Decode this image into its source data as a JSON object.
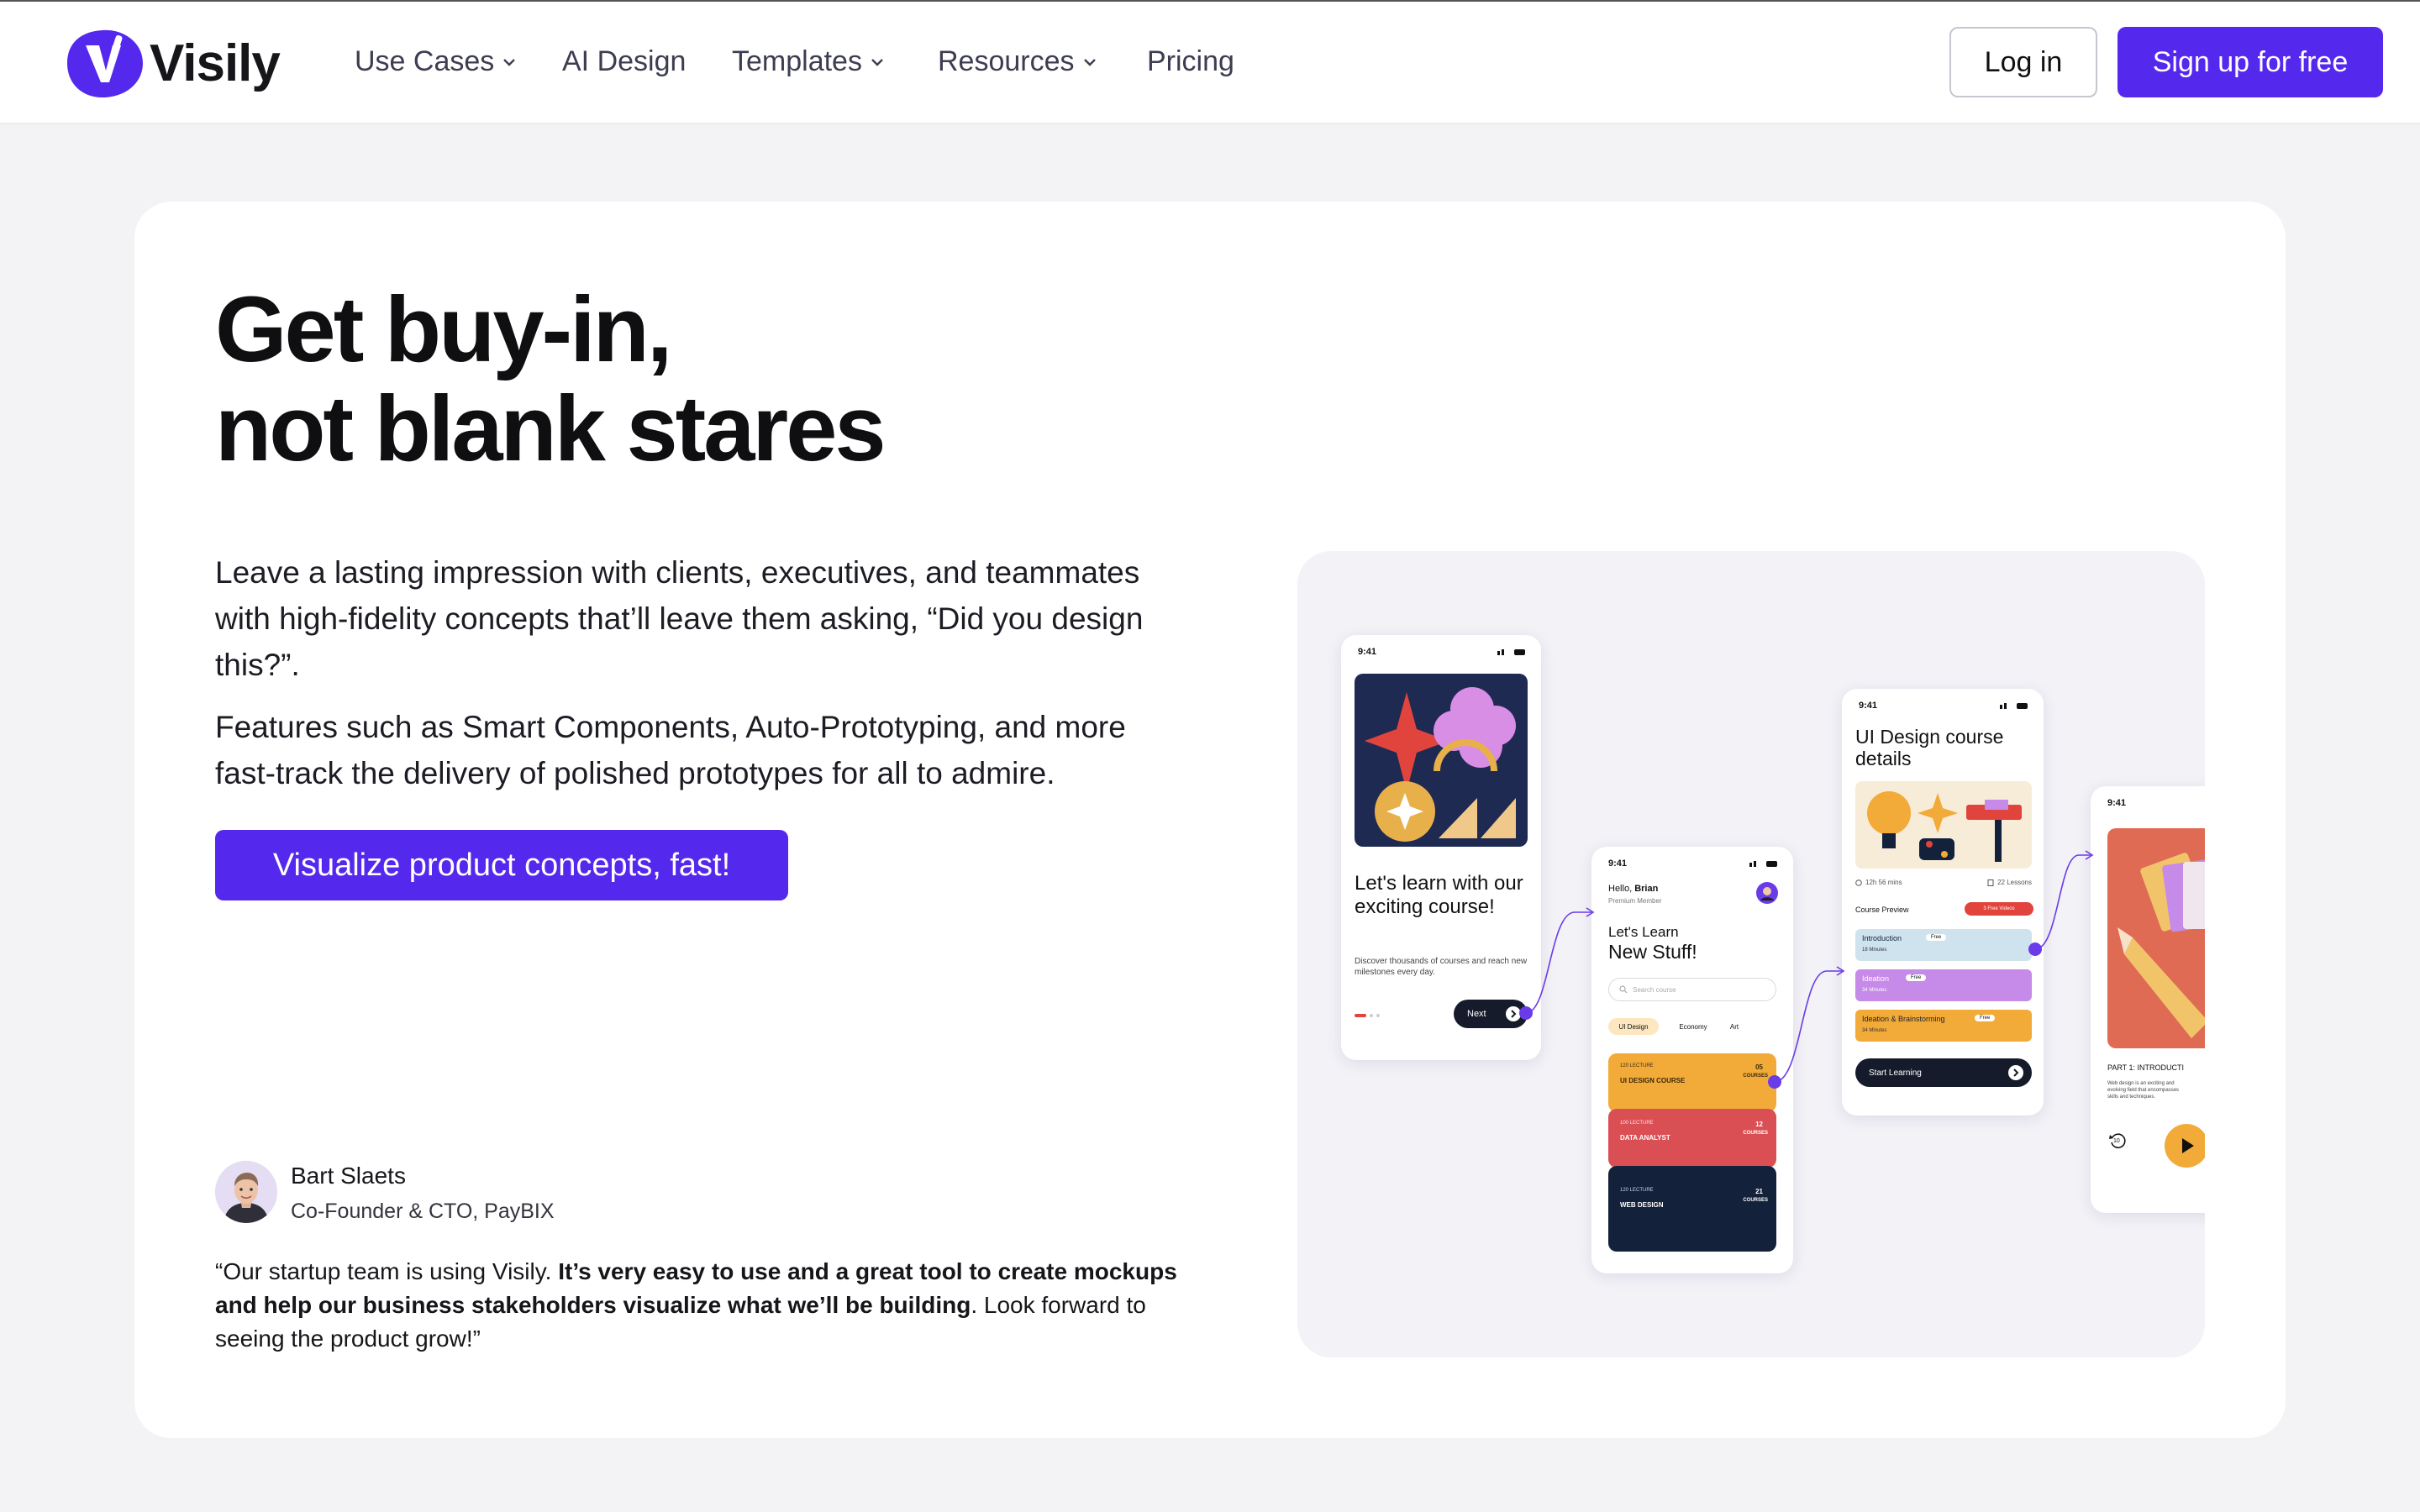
{
  "nav": {
    "brand": "Visily",
    "items": [
      {
        "label": "Use Cases",
        "has_dropdown": true
      },
      {
        "label": "AI Design",
        "has_dropdown": false
      },
      {
        "label": "Templates",
        "has_dropdown": true
      },
      {
        "label": "Resources",
        "has_dropdown": true
      },
      {
        "label": "Pricing",
        "has_dropdown": false
      }
    ],
    "login": "Log in",
    "signup": "Sign up for free"
  },
  "hero": {
    "title_line1": "Get buy-in,",
    "title_line2": "not blank stares",
    "paragraph1": "Leave a lasting impression with clients, executives, and teammates with high-fidelity concepts that’ll leave them asking, “Did you design this?”.",
    "paragraph2": "Features such as Smart Components, Auto-Prototyping, and more fast-track the delivery of polished prototypes for all to admire.",
    "cta": "Visualize product concepts, fast!"
  },
  "testimonial": {
    "name": "Bart Slaets",
    "role": "Co-Founder & CTO, PayBIX",
    "quote_start": "“Our startup team is using Visily. ",
    "quote_bold": "It’s very easy to use and a great tool to create mockups and help our business stakeholders visualize what we’ll be building",
    "quote_end": ". Look forward to seeing the product grow!”"
  },
  "showcase": {
    "phone1": {
      "time": "9:41",
      "title": "Let's learn with our exciting course!",
      "subtitle": "Discover thousands of courses and reach new milestones every day.",
      "next": "Next"
    },
    "phone2": {
      "time": "9:41",
      "greeting_prefix": "Hello, ",
      "greeting_name": "Brian",
      "membership": "Premium Member",
      "heading_small": "Let's Learn",
      "heading_big": "New Stuff!",
      "search_placeholder": "Search course",
      "chips": [
        "UI Design",
        "Economy",
        "Art"
      ],
      "courses": [
        {
          "lecture": "120 LECTURE",
          "name": "UI DESIGN COURSE",
          "count": "05",
          "count_label": "COURSES",
          "color": "#f2aa38"
        },
        {
          "lecture": "100 LECTURE",
          "name": "DATA ANALYST",
          "count": "12",
          "count_label": "COURSES",
          "color": "#d94f53"
        },
        {
          "lecture": "120 LECTURE",
          "name": "WEB DESIGN",
          "count": "21",
          "count_label": "COURSES",
          "color": "#14213a"
        }
      ]
    },
    "phone3": {
      "time": "9:41",
      "title": "UI Design course details",
      "duration": "12h 56 mins",
      "lessons": "22 Lessons",
      "preview_label": "Course Preview",
      "free_videos": "3 Free Videos",
      "lessons_list": [
        {
          "title": "Introduction",
          "badge": "Free",
          "minutes": "18 Minutes",
          "color": "#cfe3ef"
        },
        {
          "title": "Ideation",
          "badge": "Free",
          "minutes": "34 Minutes",
          "color": "#c68ae8"
        },
        {
          "title": "Ideation & Brainstorming",
          "badge": "Free",
          "minutes": "34 Minutes",
          "color": "#f2aa38"
        }
      ],
      "start": "Start Learning"
    },
    "phone4": {
      "time": "9:41",
      "part": "PART 1: INTRODUCTI",
      "desc": "Web design is an exciting and evolving field that encompasses skills and techniques.",
      "rewind": "10"
    }
  },
  "colors": {
    "accent": "#5528ee",
    "page_bg": "#f3f3f6",
    "card_bg": "#ffffff",
    "showcase_bg": "#f3f2f7"
  },
  "icons": [
    "visily-logo-icon",
    "chevron-down-icon",
    "search-icon",
    "arrow-right-icon",
    "play-icon",
    "rewind-icon",
    "lightning-icon"
  ]
}
